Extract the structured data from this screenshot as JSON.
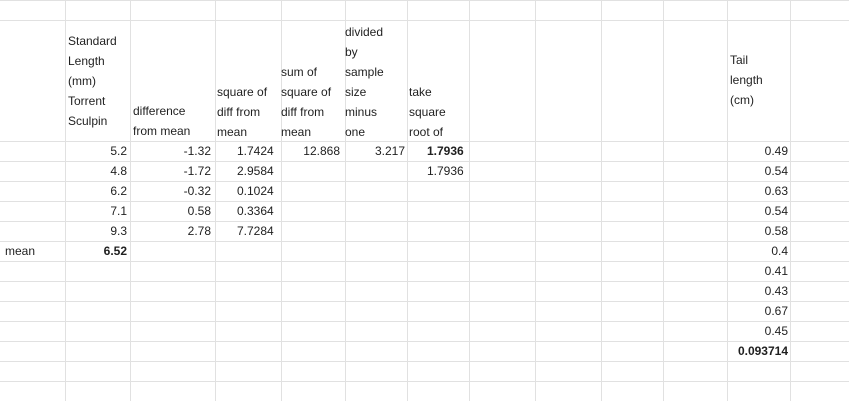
{
  "sheet": {
    "headers": {
      "standard_length": [
        "Standard",
        "Length",
        "(mm)",
        "Torrent",
        "Sculpin"
      ],
      "difference": [
        "difference",
        "from mean"
      ],
      "square_diff": [
        "square of",
        "diff from",
        "mean"
      ],
      "sum_square": [
        "sum of",
        "square of",
        "diff from",
        "mean"
      ],
      "divided": [
        "divided",
        "by",
        "sample",
        "size",
        "minus",
        "one"
      ],
      "sqrt": [
        "take",
        "square",
        "root of"
      ],
      "tail_length": [
        "Tail",
        "length",
        "(cm)"
      ]
    },
    "standard_length_values": [
      "5.2",
      "4.8",
      "6.2",
      "7.1",
      "9.3"
    ],
    "difference_values": [
      "-1.32",
      "-1.72",
      "-0.32",
      "0.58",
      "2.78"
    ],
    "square_values": [
      "1.7424",
      "2.9584",
      "0.1024",
      "0.3364",
      "7.7284"
    ],
    "sum_value": "12.868",
    "divided_value": "3.217",
    "sqrt_value_bold": "1.7936",
    "sqrt_value_plain": "1.7936",
    "mean_label": "mean",
    "mean_value": "6.52",
    "tail_values": [
      "0.49",
      "0.54",
      "0.63",
      "0.54",
      "0.58",
      "0.4",
      "0.41",
      "0.43",
      "0.67",
      "0.45"
    ],
    "tail_result": "0.093714"
  }
}
